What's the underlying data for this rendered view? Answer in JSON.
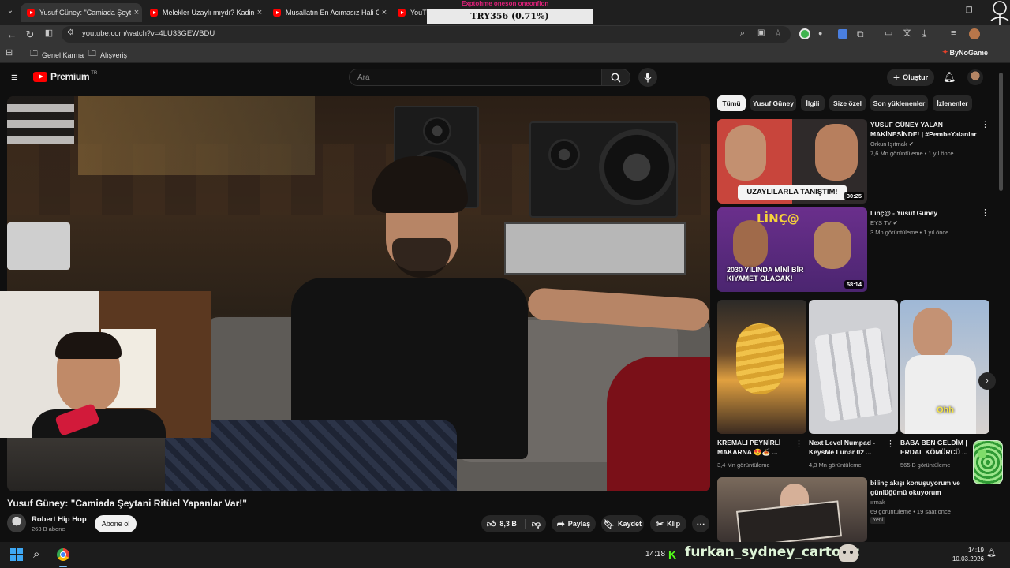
{
  "browser": {
    "tabs": [
      {
        "label": "Yusuf Güney: \"Camiada Şeytani",
        "active": true
      },
      {
        "label": "Melekler Uzaylı mıydı? Kadim M",
        "active": false
      },
      {
        "label": "Musallatın En Acımasız Hali Ge",
        "active": false
      },
      {
        "label": "YouTube",
        "active": false
      }
    ],
    "address": "youtube.com/watch?v=4LU33GEWBDU",
    "bookmarks": [
      {
        "label": "Genel Karma"
      },
      {
        "label": "Alışveriş"
      }
    ],
    "extension_brand": "ByNoGame"
  },
  "overlay": {
    "ticker_top": "Exptohme oneson oneonfion",
    "price": "TRY356 (0.71%)",
    "chat_time": "14:18",
    "chat_user": "furkan_sydney_carton :"
  },
  "youtube": {
    "logo_text": "Premium",
    "logo_badge": "TR",
    "search_placeholder": "Ara",
    "create_label": "Oluştur",
    "video_title": "Yusuf Güney: \"Camiada Şeytani Ritüel Yapanlar Var!\"",
    "channel": {
      "name": "Robert Hip Hop",
      "subs": "263 B abone",
      "subscribe_label": "Abone ol"
    },
    "actions": {
      "likes": "8,3 B",
      "share": "Paylaş",
      "save": "Kaydet",
      "clip": "Klip"
    },
    "chips": [
      "Tümü",
      "Yusuf Güney",
      "İlgili",
      "Sizе özel",
      "Son yüklenenler",
      "İzlenenler"
    ],
    "sidebar": {
      "videos": [
        {
          "title": "YUSUF GÜNEY YALAN MAKİNESİNDE! | #PembeYalanlar",
          "channel": "Orkun Işıtmak",
          "meta": "7,6 Mn görüntüleme • 1 yıl önce",
          "duration": "30:25",
          "thumb_text": "UZAYLILARLA TANIŞTIM!"
        },
        {
          "title": "Linç@ - Yusuf Güney",
          "channel": "EYS TV",
          "meta": "3 Mn görüntüleme • 1 yıl önce",
          "duration": "58:14",
          "thumb_text": "2030 YILINDA MİNİ BİR KIYAMET OLACAK!",
          "thumb_logo": "LİNÇ@"
        },
        {
          "title": "bilinç akışı konuşuyorum ve günlüğümü okuyorum",
          "channel": "ırmak",
          "meta": "69 görüntüleme • 19 saat önce",
          "badge": "Yeni"
        }
      ],
      "shorts": [
        {
          "title": "KREMALI PEYNİRLİ MAKARNA 😍🍝 ...",
          "views": "3,4 Mn görüntüleme"
        },
        {
          "title": "Next Level Numpad - KeysMe Lunar 02 ...",
          "views": "4,3 Mn görüntüleme"
        },
        {
          "title": "BABA BEN GELDİM | ERDAL KÖMÜRCÜ ...",
          "views": "565 B görüntüleme",
          "thumb_text": "Ohh"
        }
      ]
    }
  },
  "taskbar": {
    "time": "14:19",
    "date": "10.03.2026"
  },
  "colors": {
    "yt_red": "#ff0000",
    "accent_pink": "#e0207a",
    "bg": "#0f0f0f"
  }
}
